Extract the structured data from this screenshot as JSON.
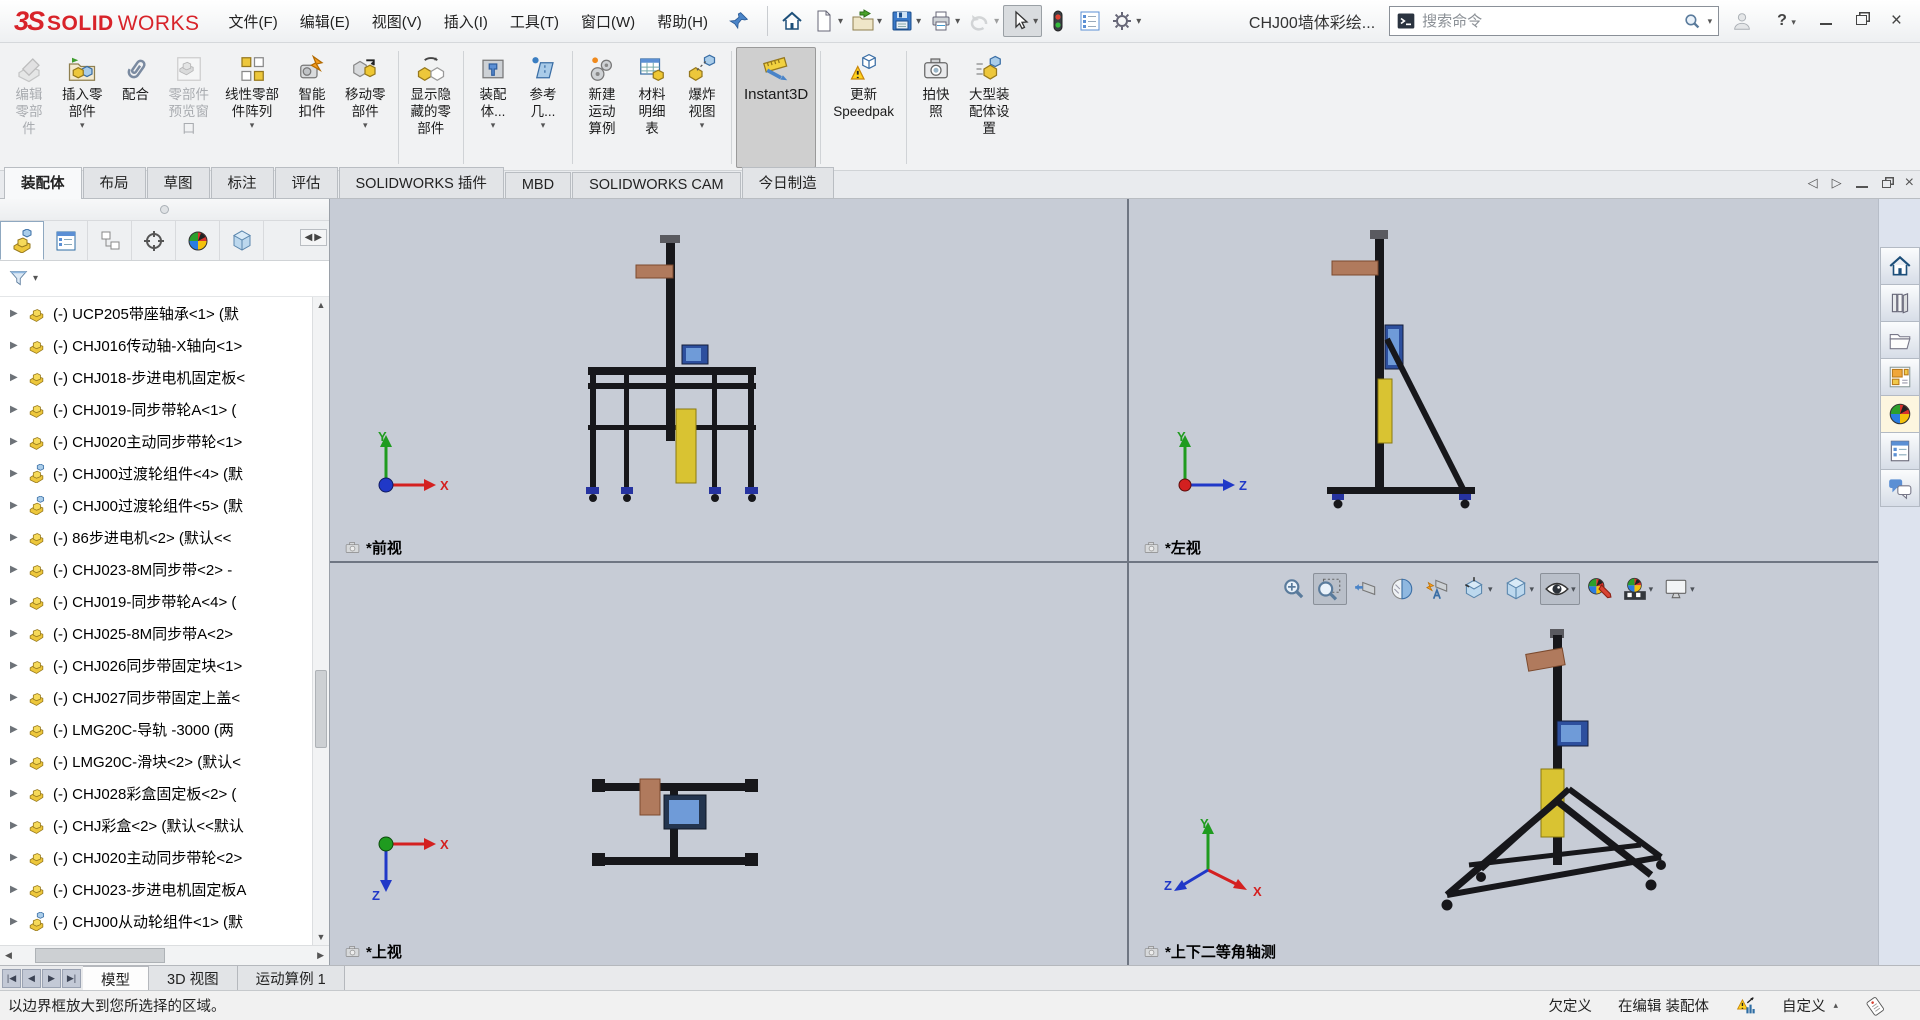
{
  "app": {
    "logo_mark": "3S",
    "logo_bold": "SOLID",
    "logo_rest": "WORKS",
    "doc_title": "CHJ00墙体彩绘...",
    "search_placeholder": "搜索命令"
  },
  "menubar": {
    "items": [
      "文件(F)",
      "编辑(E)",
      "视图(V)",
      "插入(I)",
      "工具(T)",
      "窗口(W)",
      "帮助(H)"
    ]
  },
  "quickbar": [
    {
      "name": "home-icon",
      "icon": "house"
    },
    {
      "name": "new-document-icon",
      "icon": "page",
      "dropdown": true
    },
    {
      "name": "open-icon",
      "icon": "openfolder",
      "dropdown": true
    },
    {
      "name": "save-icon",
      "icon": "floppy",
      "dropdown": true
    },
    {
      "name": "print-icon",
      "icon": "printer",
      "dropdown": true
    },
    {
      "name": "undo-icon",
      "icon": "undo",
      "dropdown": true,
      "disabled": true
    },
    {
      "name": "select-cursor-icon",
      "icon": "cursor",
      "dropdown": true,
      "pressed": true
    },
    {
      "name": "rebuild-traffic-light-icon",
      "icon": "traffic"
    },
    {
      "name": "options-list-icon",
      "icon": "listopts"
    },
    {
      "name": "settings-gear-icon",
      "icon": "gear",
      "dropdown": true
    }
  ],
  "ribbon": {
    "buttons": [
      {
        "icon": "edit-component",
        "lines": [
          "编辑",
          "零部",
          "件"
        ],
        "disabled": true
      },
      {
        "icon": "insert-component",
        "lines": [
          "插入零",
          "部件"
        ],
        "dropdown": true
      },
      {
        "icon": "mate",
        "lines": [
          "配合"
        ]
      },
      {
        "icon": "component-preview",
        "lines": [
          "零部件",
          "预览窗",
          "口"
        ],
        "disabled": true
      },
      {
        "icon": "linear-pattern",
        "lines": [
          "线性零部",
          "件阵列"
        ],
        "dropdown": true
      },
      {
        "icon": "smart-fasteners",
        "lines": [
          "智能",
          "扣件"
        ]
      },
      {
        "icon": "move-component",
        "lines": [
          "移动零",
          "部件"
        ],
        "dropdown": true,
        "sep_after": true
      },
      {
        "icon": "show-hidden",
        "lines": [
          "显示隐",
          "藏的零",
          "部件"
        ],
        "sep_after": true
      },
      {
        "icon": "assembly-features",
        "lines": [
          "装配",
          "体..."
        ],
        "dropdown": true
      },
      {
        "icon": "reference-geometry",
        "lines": [
          "参考",
          "几..."
        ],
        "dropdown": true,
        "sep_after": true
      },
      {
        "icon": "motion-study",
        "lines": [
          "新建",
          "运动",
          "算例"
        ]
      },
      {
        "icon": "bom",
        "lines": [
          "材料",
          "明细",
          "表"
        ]
      },
      {
        "icon": "exploded-view",
        "lines": [
          "爆炸",
          "视图"
        ],
        "dropdown": true,
        "sep_after": true
      },
      {
        "icon": "instant3d",
        "lines": [
          "Instant3D"
        ],
        "active": true,
        "sep_after": true
      },
      {
        "icon": "update-speedpak",
        "lines": [
          "更新",
          "Speedpak"
        ],
        "sep_after": true
      },
      {
        "icon": "snapshot",
        "lines": [
          "拍快",
          "照"
        ]
      },
      {
        "icon": "large-assembly",
        "lines": [
          "大型装",
          "配体设",
          "置"
        ]
      }
    ],
    "tabs": [
      "装配体",
      "布局",
      "草图",
      "标注",
      "评估",
      "SOLIDWORKS 插件",
      "MBD",
      "SOLIDWORKS CAM",
      "今日制造"
    ],
    "active_tab": "装配体"
  },
  "feature_panel": {
    "tabs": [
      {
        "name": "featuremanager-tree-tab",
        "icon": "asm",
        "active": true
      },
      {
        "name": "propertymanager-tab",
        "icon": "fmtree"
      },
      {
        "name": "configurationmanager-tab",
        "icon": "hier"
      },
      {
        "name": "dimxpertmanager-tab",
        "icon": "target"
      },
      {
        "name": "displaymanager-tab",
        "icon": "sphere4"
      },
      {
        "name": "cam-tab",
        "icon": "cubeblue"
      }
    ],
    "tree_items": [
      {
        "type": "part",
        "label": "(-) UCP205带座轴承<1> (默"
      },
      {
        "type": "part",
        "label": "(-) CHJ016传动轴-X轴向<1>"
      },
      {
        "type": "part",
        "label": "(-) CHJ018-步进电机固定板<"
      },
      {
        "type": "part",
        "label": "(-) CHJ019-同步带轮A<1> ("
      },
      {
        "type": "part",
        "label": "(-) CHJ020主动同步带轮<1>"
      },
      {
        "type": "asm",
        "label": "(-) CHJ00过渡轮组件<4> (默"
      },
      {
        "type": "asm",
        "label": "(-) CHJ00过渡轮组件<5> (默"
      },
      {
        "type": "part",
        "label": "(-) 86步进电机<2> (默认<<"
      },
      {
        "type": "part",
        "label": "(-) CHJ023-8M同步带<2> -"
      },
      {
        "type": "part",
        "label": "(-) CHJ019-同步带轮A<4> ("
      },
      {
        "type": "part",
        "label": "(-) CHJ025-8M同步带A<2>"
      },
      {
        "type": "part",
        "label": "(-) CHJ026同步带固定块<1>"
      },
      {
        "type": "part",
        "label": "(-) CHJ027同步带固定上盖<"
      },
      {
        "type": "part",
        "label": "(-) LMG20C-导轨 -3000 (两"
      },
      {
        "type": "part",
        "label": "(-) LMG20C-滑块<2> (默认<"
      },
      {
        "type": "part",
        "label": "(-) CHJ028彩盒固定板<2> ("
      },
      {
        "type": "part",
        "label": "(-) CHJ彩盒<2> (默认<<默认"
      },
      {
        "type": "part",
        "label": "(-) CHJ020主动同步带轮<2>"
      },
      {
        "type": "part",
        "label": "(-) CHJ023-步进电机固定板A"
      },
      {
        "type": "asm",
        "label": "(-) CHJ00从动轮组件<1> (默"
      }
    ]
  },
  "viewports": [
    {
      "label": "*前视"
    },
    {
      "label": "*左视"
    },
    {
      "label": "*上视"
    },
    {
      "label": "*上下二等角轴测"
    }
  ],
  "axis": {
    "x": "X",
    "y": "Y",
    "z": "Z"
  },
  "headsup": [
    {
      "name": "zoom-fit-icon",
      "icon": "zoomfit"
    },
    {
      "name": "zoom-to-area-icon",
      "icon": "zoomarea",
      "pressed": true
    },
    {
      "name": "previous-view-icon",
      "icon": "prevview"
    },
    {
      "name": "section-view-icon",
      "icon": "section"
    },
    {
      "name": "dynamic-annotation-icon",
      "icon": "annot"
    },
    {
      "name": "view-orientation-icon",
      "icon": "vieworient",
      "dropdown": true
    },
    {
      "name": "display-style-icon",
      "icon": "cubeblue",
      "dropdown": true
    },
    {
      "name": "hide-show-items-icon",
      "icon": "eye",
      "pressed": true,
      "dropdown": true
    },
    {
      "name": "edit-appearance-icon",
      "icon": "spherepencil"
    },
    {
      "name": "apply-scene-icon",
      "icon": "scene",
      "dropdown": true
    },
    {
      "name": "view-settings-icon",
      "icon": "monitor",
      "dropdown": true
    }
  ],
  "taskpane": [
    {
      "name": "taskpane-home-icon",
      "icon": "house"
    },
    {
      "name": "design-library-icon",
      "icon": "books"
    },
    {
      "name": "file-explorer-icon",
      "icon": "folderopen"
    },
    {
      "name": "view-palette-icon",
      "icon": "palette"
    },
    {
      "name": "appearances-icon",
      "icon": "sphere4",
      "active": true
    },
    {
      "name": "custom-properties-icon",
      "icon": "props"
    },
    {
      "name": "forum-icon",
      "icon": "chat"
    }
  ],
  "bottom_tabs": [
    {
      "label": "模型",
      "active": true
    },
    {
      "label": "3D 视图",
      "active": false
    },
    {
      "label": "运动算例 1",
      "active": false
    }
  ],
  "statusbar": {
    "message": "以边界框放大到您所选择的区域。",
    "constraint_state": "欠定义",
    "editing_state": "在编辑 装配体",
    "custom_label": "自定义"
  },
  "colors": {
    "accent_red": "#d8232a",
    "viewport_bg": "#c7ccd6",
    "divider": "#6f7683",
    "frame": "#17171b",
    "tan": "#b07a5d",
    "blue": "#2d4f9e",
    "blue_light": "#6f9bd8",
    "yellow": "#d9c332",
    "feet_blue": "#2633a0",
    "axis_x": "#d42020",
    "axis_y": "#1f9b1f",
    "axis_z": "#2038c8"
  }
}
